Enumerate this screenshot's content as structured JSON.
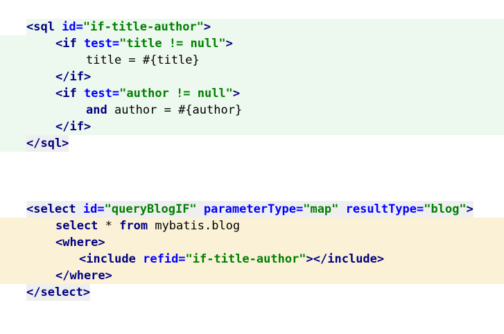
{
  "editor": {
    "lines": [
      {
        "segs": [
          [
            "tag",
            "<sql "
          ],
          [
            "attr",
            "id="
          ],
          [
            "str",
            "\"if-title-author\""
          ],
          [
            "tag",
            ">"
          ]
        ]
      },
      {
        "segs": [
          [
            "tag",
            "<if "
          ],
          [
            "attr",
            "test="
          ],
          [
            "str",
            "\"title != null\""
          ],
          [
            "tag",
            ">"
          ]
        ]
      },
      {
        "segs": [
          [
            "plain",
            "title = #{title}"
          ]
        ]
      },
      {
        "segs": [
          [
            "tag",
            "</if>"
          ]
        ]
      },
      {
        "segs": [
          [
            "tag",
            "<if "
          ],
          [
            "attr",
            "test="
          ],
          [
            "str",
            "\"author != null\""
          ],
          [
            "tag",
            ">"
          ]
        ]
      },
      {
        "segs": [
          [
            "sqlkw",
            "and"
          ],
          [
            "plain",
            " author = #{author}"
          ]
        ]
      },
      {
        "segs": [
          [
            "tag",
            "</if>"
          ]
        ]
      },
      {
        "segs": [
          [
            "tag",
            "</sql>"
          ]
        ]
      },
      {
        "segs": [
          [
            "tag",
            "<select "
          ],
          [
            "attr",
            "id="
          ],
          [
            "str",
            "\"queryBlogIF\""
          ],
          [
            "plain",
            " "
          ],
          [
            "attr",
            "parameterType="
          ],
          [
            "str",
            "\"map\""
          ],
          [
            "plain",
            " "
          ],
          [
            "attr",
            "resultType="
          ],
          [
            "str",
            "\"blog\""
          ],
          [
            "tag",
            ">"
          ]
        ]
      },
      {
        "segs": [
          [
            "sqlkw",
            "select"
          ],
          [
            "plain",
            " * "
          ],
          [
            "sqlkw",
            "from"
          ],
          [
            "plain",
            " mybatis.blog"
          ]
        ]
      },
      {
        "segs": [
          [
            "tag",
            "<where>"
          ]
        ]
      },
      {
        "segs": [
          [
            "tag",
            "<include "
          ],
          [
            "attr",
            "refid="
          ],
          [
            "str",
            "\"if-title-author\""
          ],
          [
            "tag",
            "></include>"
          ]
        ]
      },
      {
        "segs": [
          [
            "tag",
            "</where>"
          ]
        ]
      },
      {
        "segs": [
          [
            "tag",
            "</select>"
          ]
        ]
      }
    ]
  }
}
